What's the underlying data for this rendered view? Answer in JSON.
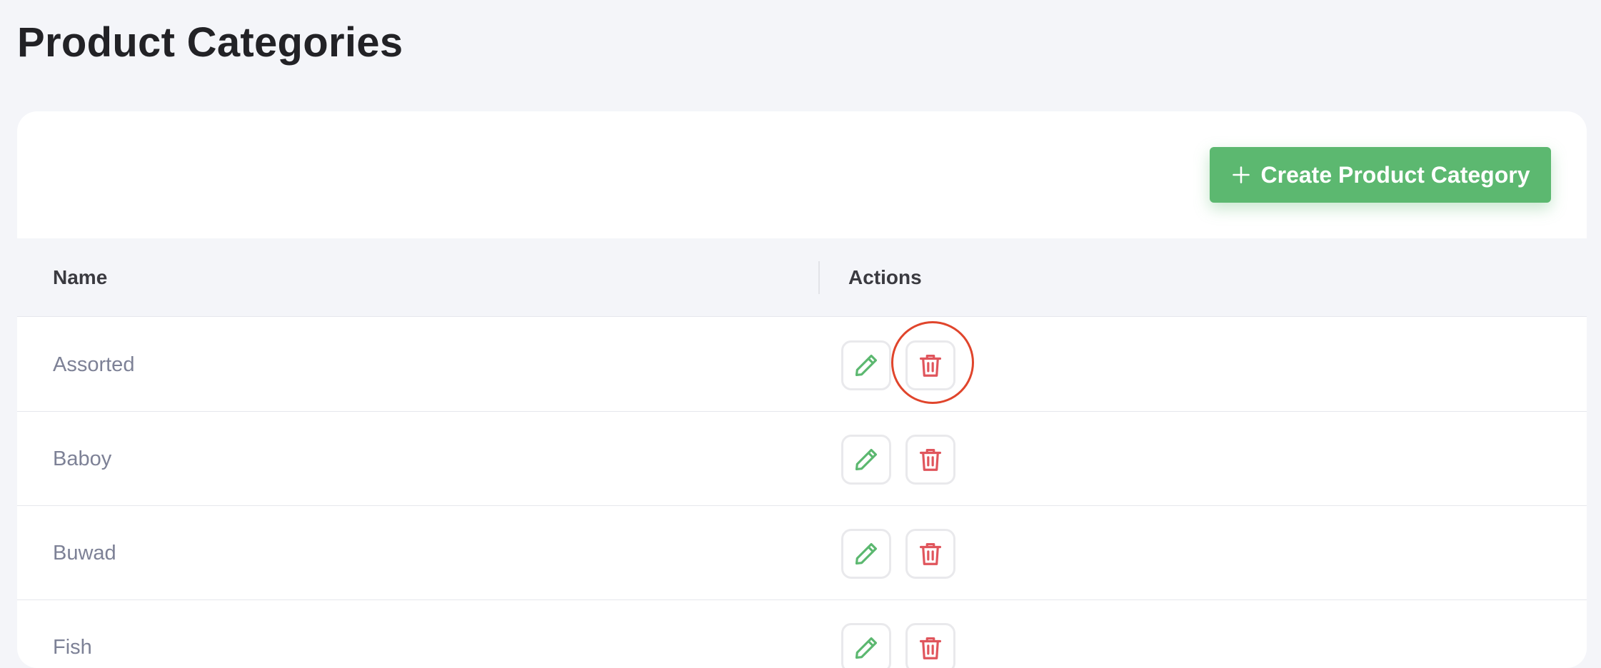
{
  "page": {
    "title": "Product Categories"
  },
  "toolbar": {
    "create_label": "Create Product Category",
    "create_icon": "plus-icon"
  },
  "table": {
    "columns": [
      "Name",
      "Actions"
    ],
    "rows": [
      {
        "name": "Assorted",
        "highlighted_action": "delete"
      },
      {
        "name": "Baboy"
      },
      {
        "name": "Buwad"
      },
      {
        "name": "Fish"
      }
    ],
    "row_actions": [
      {
        "name": "edit",
        "icon": "pencil-icon",
        "color": "#5cb870"
      },
      {
        "name": "delete",
        "icon": "trash-icon",
        "color": "#e0555c"
      }
    ]
  },
  "colors": {
    "primary": "#5cb870",
    "danger": "#e0555c",
    "highlight_ring": "#e0452c",
    "background": "#f4f5f9"
  }
}
